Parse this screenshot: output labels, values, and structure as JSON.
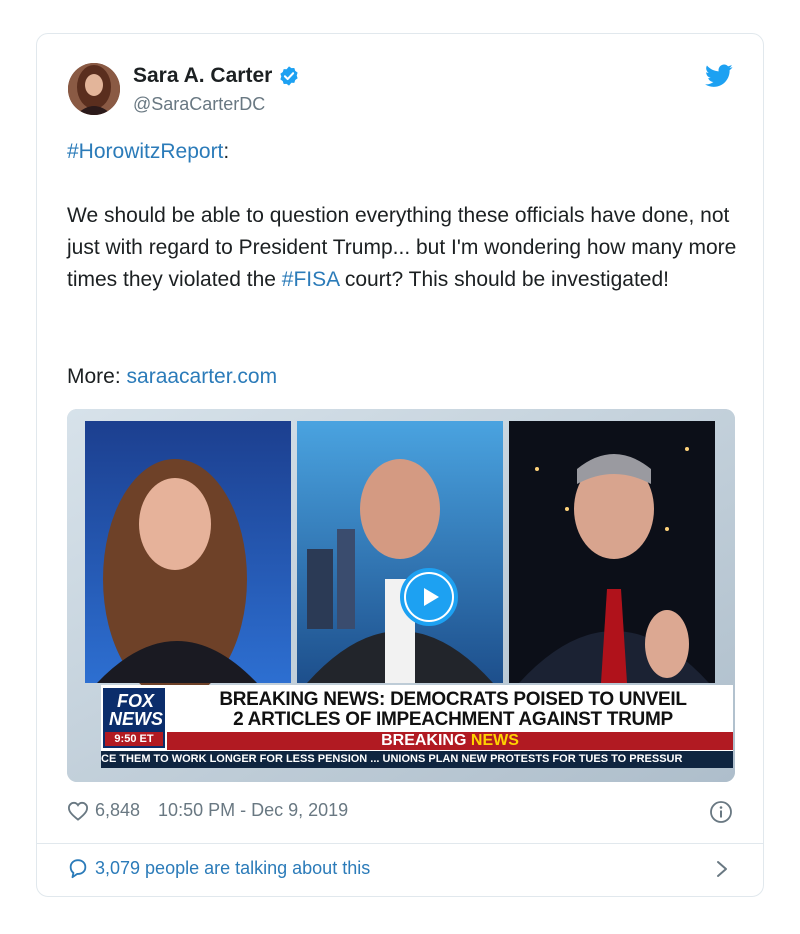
{
  "author": {
    "name": "Sara A. Carter",
    "handle": "@SaraCarterDC"
  },
  "tweet": {
    "hashtag_line": "#HorowitzReport",
    "hashtag_suffix": ":",
    "body_part1": "We should be able to question everything these officials have done, not just with regard to President Trump... but I'm wondering how many more times they violated the ",
    "body_hashtag": "#FISA",
    "body_part2": " court? This should be investigated!",
    "more_label": "More: ",
    "more_link": "saraacarter.com"
  },
  "media": {
    "logo_line1": "FOX",
    "logo_line2": "NEWS",
    "clock": "9:50 ET",
    "headline_line1": "BREAKING NEWS: DEMOCRATS POISED TO UNVEIL",
    "headline_line2": "2 ARTICLES OF IMPEACHMENT AGAINST TRUMP",
    "breaking_word1": "BREAKING",
    "breaking_word2": "NEWS",
    "ticker": "CE THEM TO WORK LONGER FOR LESS PENSION ... UNIONS PLAN NEW PROTESTS FOR TUES TO PRESSUR"
  },
  "footer": {
    "likes": "6,848",
    "timestamp": "10:50 PM - Dec 9, 2019",
    "talking": "3,079 people are talking about this"
  },
  "icons": {
    "verified": "verified-badge-icon",
    "twitter": "twitter-bird-icon",
    "heart": "heart-icon",
    "info": "info-icon",
    "comment": "speech-bubble-icon",
    "chevron": "chevron-right-icon",
    "play": "play-icon"
  },
  "colors": {
    "link": "#2b7bb9",
    "twitter_blue": "#1da1f2",
    "muted": "#697882",
    "fox_red": "#b11a22",
    "fox_navy": "#0b2d6b"
  }
}
